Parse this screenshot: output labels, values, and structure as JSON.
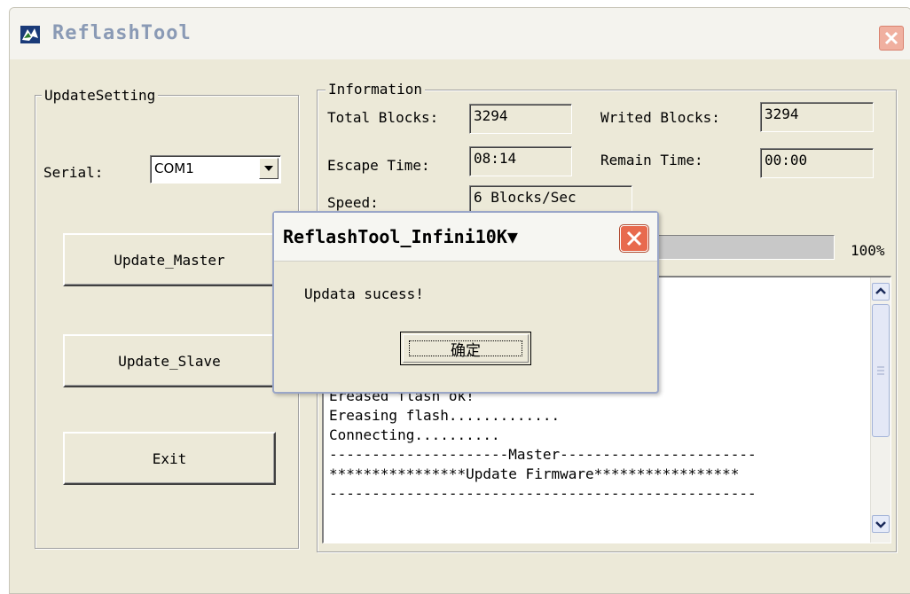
{
  "window": {
    "title": "ReflashTool"
  },
  "update_setting": {
    "group_label": "UpdateSetting",
    "serial_label": "Serial:",
    "serial_value": "COM1",
    "update_master_label": "Update_Master",
    "update_slave_label": "Update_Slave",
    "exit_label": "Exit"
  },
  "information": {
    "group_label": "Information",
    "total_blocks_label": "Total Blocks:",
    "total_blocks_value": "3294",
    "writed_blocks_label": "Writed Blocks:",
    "writed_blocks_value": "3294",
    "escape_time_label": "Escape Time:",
    "escape_time_value": "08:14",
    "remain_time_label": "Remain Time:",
    "remain_time_value": "00:00",
    "speed_label": "Speed:",
    "speed_value": "6 Blocks/Sec",
    "progress_percent_text": "100%",
    "progress_fraction": 1.0
  },
  "log": {
    "lines": [
      "Ereased flash ok!",
      "Ereasing flash.............",
      "Connecting..........",
      "---------------------Master-----------------------",
      "****************Update Firmware*****************",
      "--------------------------------------------------"
    ]
  },
  "dialog": {
    "title": "ReflashTool_Infini10K▼",
    "message": "Updata sucess!",
    "ok_label": "确定"
  },
  "colors": {
    "window_bg": "#ece9d8",
    "dialog_close": "#e86a4e",
    "title_text": "#8a9ab5"
  }
}
